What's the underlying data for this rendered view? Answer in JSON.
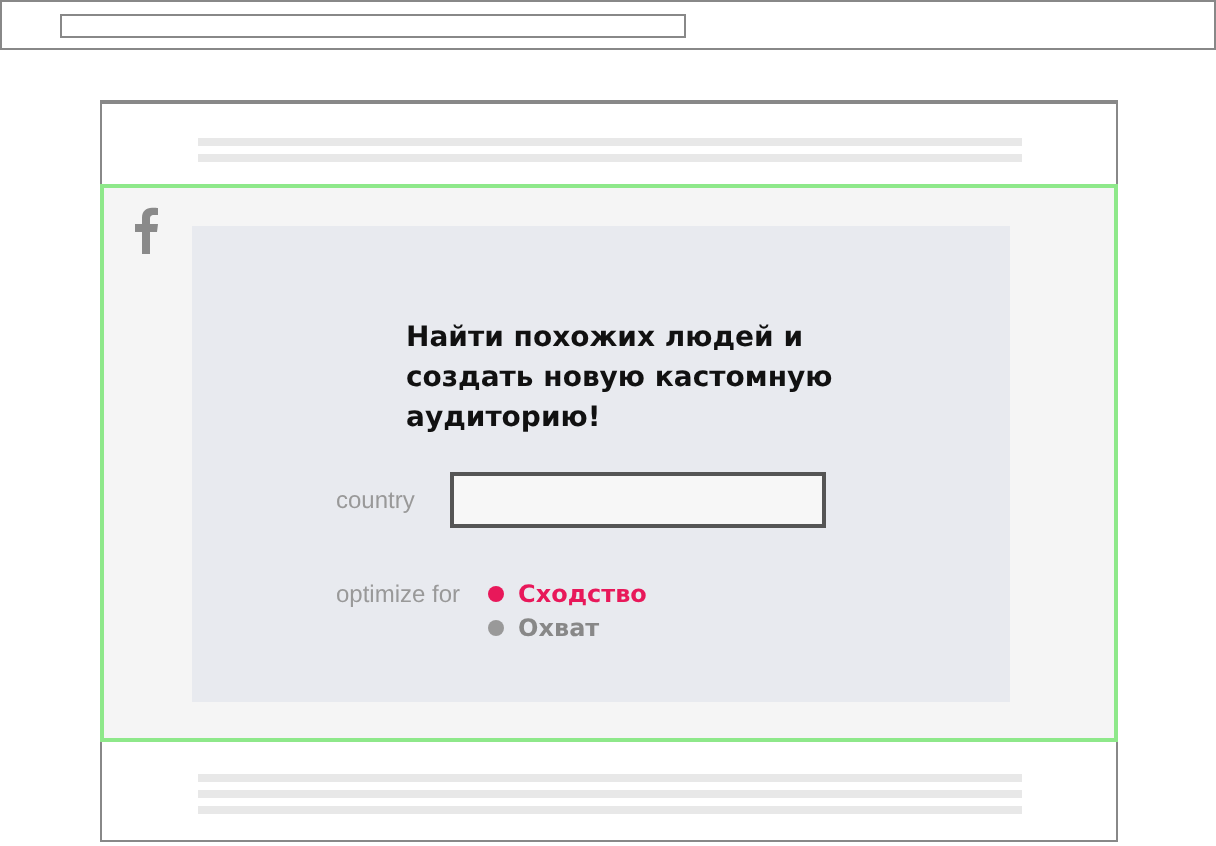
{
  "heading": "Найти похожих людей и создать новую кастомную аудиторию!",
  "fields": [
    {
      "label": "country"
    }
  ],
  "optimize": {
    "label": "optimize for",
    "options": [
      {
        "label": "Сходство",
        "selected": true
      },
      {
        "label": "Охват",
        "selected": false
      }
    ]
  }
}
